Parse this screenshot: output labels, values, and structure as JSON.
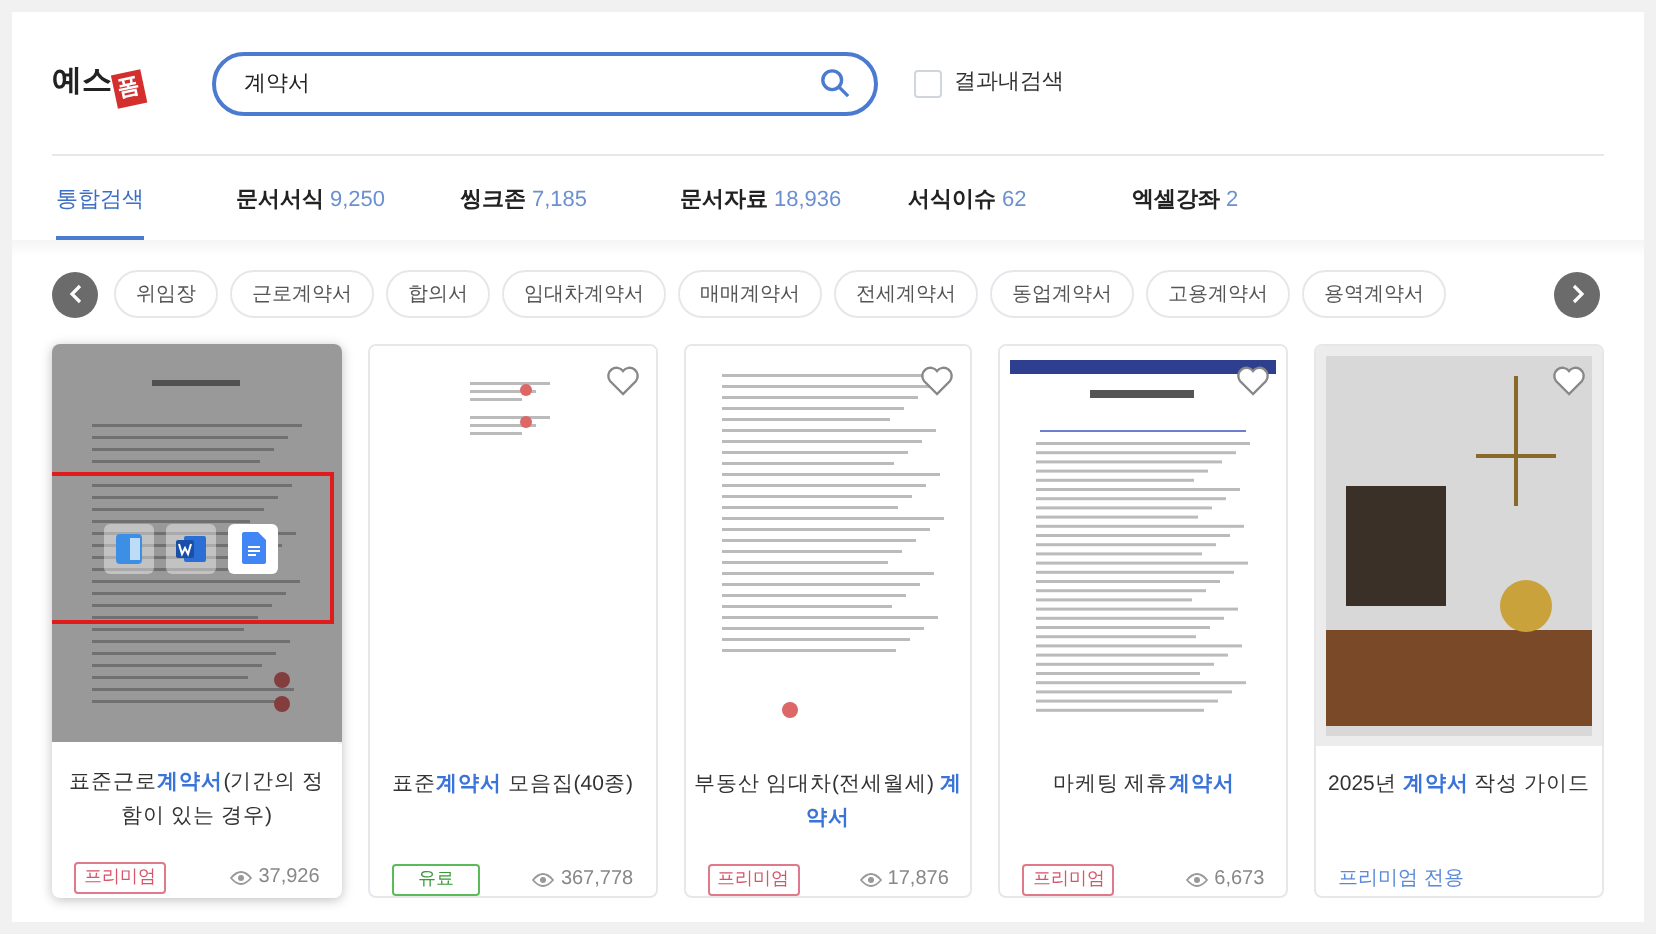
{
  "logo": {
    "text": "예스",
    "mark": "폼"
  },
  "search": {
    "value": "계약서"
  },
  "within_results": {
    "label": "결과내검색",
    "checked": false
  },
  "tabs": [
    {
      "label": "통합검색",
      "selected": true
    },
    {
      "label": "문서서식",
      "count": "9,250",
      "selected": false
    },
    {
      "label": "씽크존",
      "count": "7,185",
      "selected": false
    },
    {
      "label": "문서자료",
      "count": "18,936",
      "selected": false
    },
    {
      "label": "서식이슈",
      "count": "62",
      "selected": false
    },
    {
      "label": "엑셀강좌",
      "count": "2",
      "selected": false
    }
  ],
  "chips": [
    "위임장",
    "근로계약서",
    "합의서",
    "임대차계약서",
    "매매계약서",
    "전세계약서",
    "동업계약서",
    "고용계약서",
    "용역계약서"
  ],
  "cards": [
    {
      "title": "표준근로**계약서**(기간의 정함이 있는 경우)",
      "kind": "form",
      "hovered": true,
      "badge": {
        "kind": "premium",
        "label": "프리미엄"
      },
      "views": "37,926"
    },
    {
      "title": "표준**계약서** 모음집(40종)",
      "kind": "sparse",
      "hovered": false,
      "favorite": false,
      "badge": {
        "kind": "paid",
        "label": "유료"
      },
      "views": "367,778"
    },
    {
      "title": "부동산 임대차(전세월세) **계약서**",
      "kind": "text",
      "hovered": false,
      "favorite": false,
      "badge": {
        "kind": "premium",
        "label": "프리미엄"
      },
      "views": "17,876"
    },
    {
      "title": "마케팅 제휴**계약서**",
      "kind": "banner",
      "hovered": false,
      "favorite": false,
      "badge": {
        "kind": "premium",
        "label": "프리미엄"
      },
      "views": "6,673"
    },
    {
      "title": "2025년 **계약서** 작성 가이드",
      "kind": "cover",
      "hovered": false,
      "favorite": false,
      "badge": {
        "kind": "premium-only",
        "label": "프리미엄 전용"
      }
    }
  ]
}
